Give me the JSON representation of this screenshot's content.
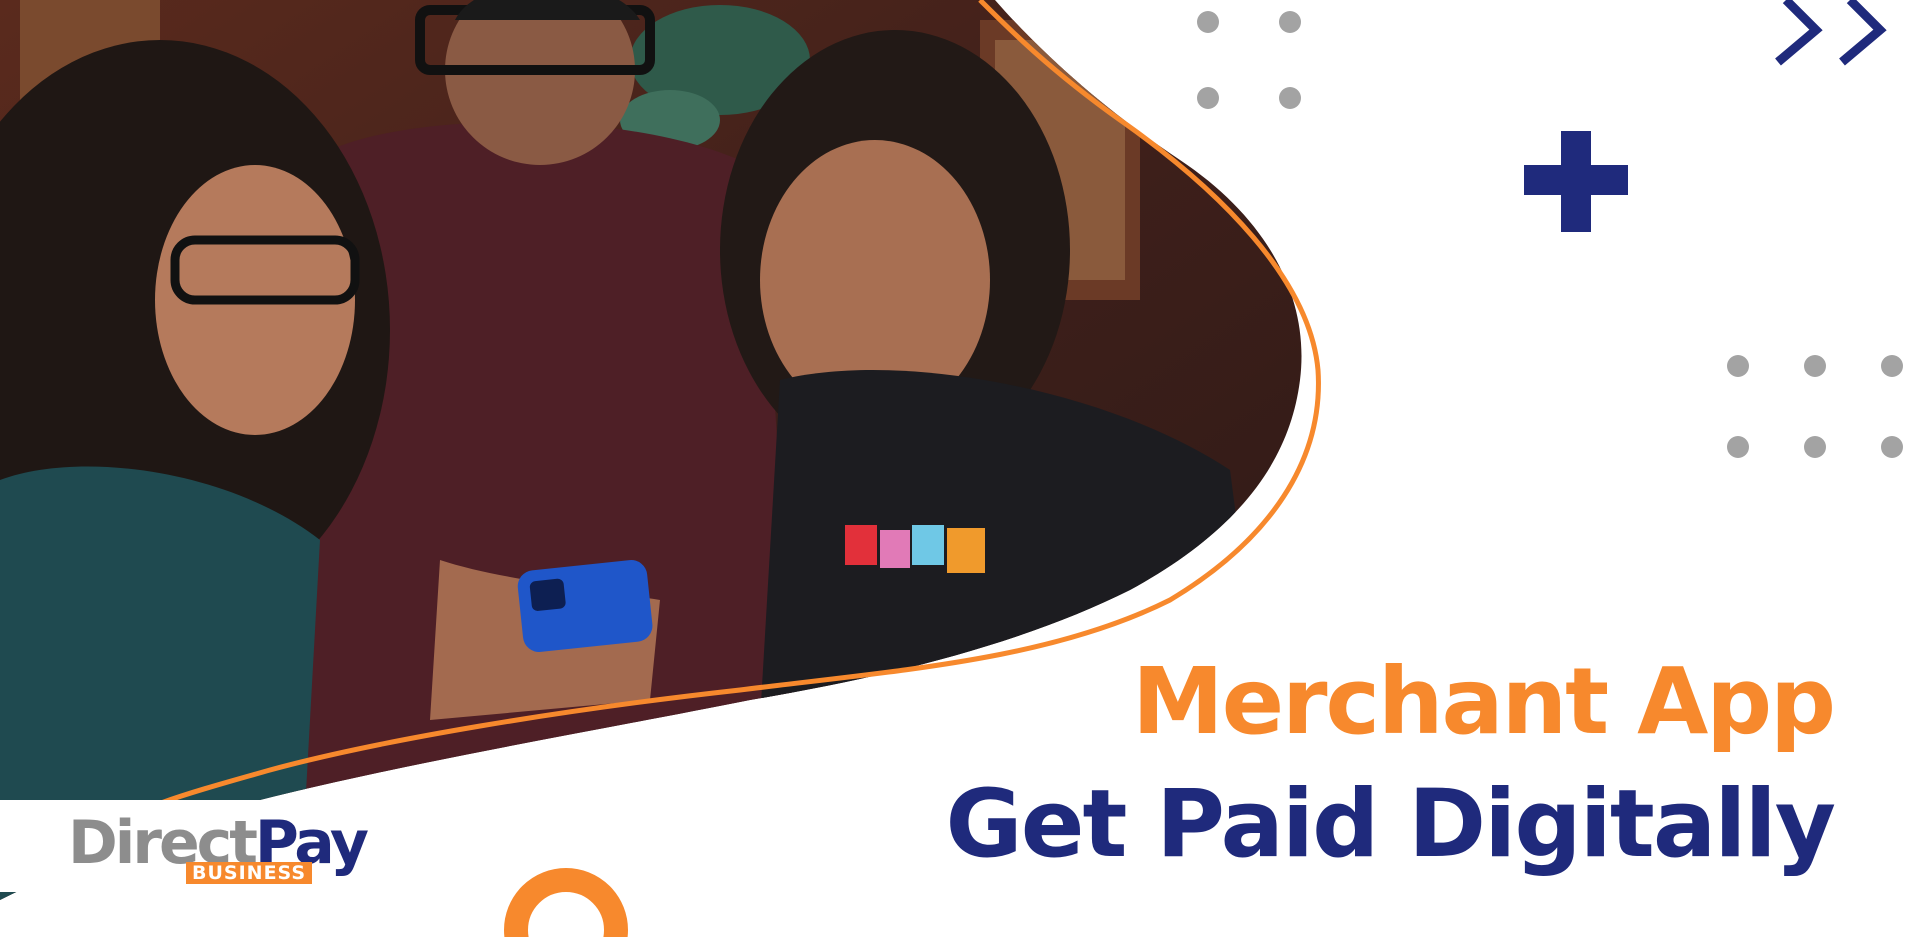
{
  "headline": {
    "line1": "Merchant App",
    "line2": "Get Paid Digitally"
  },
  "logo": {
    "part1": "Direct",
    "part2": "Pay",
    "sub": "BUSINESS"
  },
  "colors": {
    "orange": "#f7892d",
    "navy": "#1f2a7c",
    "grey": "#a3a3a3"
  },
  "photo": {
    "subject": "three-people-looking-at-smartphone",
    "icon": "photo-placeholder-icon"
  },
  "decorations": [
    "dots-grid-icon",
    "plus-icon",
    "chevrons-icon",
    "ring-icon",
    "swoosh-line-icon"
  ]
}
